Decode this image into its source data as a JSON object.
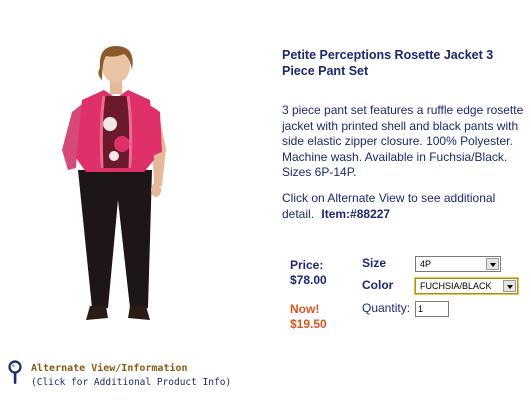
{
  "product": {
    "title": "Petite Perceptions Rosette Jacket 3 Piece Pant Set",
    "description": "3 piece pant set features a ruffle edge rosette jacket with printed shell and black pants with side elastic zipper closure. 100% Polyester. Machine wash. Available in Fuchsia/Black. Sizes 6P-14P.",
    "alt_view_note": "Click on Alternate View to see additional detail.",
    "item_number": "Item:#88227"
  },
  "pricing": {
    "price_label": "Price:",
    "price_value": "$78.00",
    "sale_label": "Now!",
    "sale_value": "$19.50"
  },
  "options": {
    "size_label": "Size",
    "size_value": "4P",
    "color_label": "Color",
    "color_value": "FUCHSIA/BLACK",
    "quantity_label": "Quantity:",
    "quantity_value": "1"
  },
  "alt_view": {
    "link_label": "Alternate View/Information",
    "sub_label": "(Click for Additional Product Info)"
  },
  "colors": {
    "text_navy": "#1a2a6c",
    "sale_orange": "#d9541e",
    "link_brown": "#8a5a16",
    "jacket_fuchsia": "#e0306a"
  },
  "icons": {
    "magnifier": "magnifier-icon",
    "dropdown": "chevron-down-icon"
  }
}
